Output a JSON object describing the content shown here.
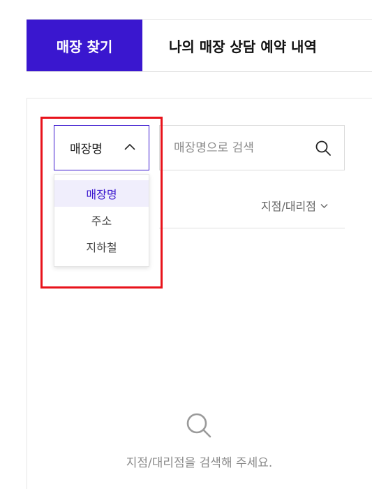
{
  "tabs": [
    {
      "label": "매장 찾기",
      "active": true
    },
    {
      "label": "나의 매장 상담 예약 내역",
      "active": false
    }
  ],
  "search": {
    "type_selected": "매장명",
    "type_options": [
      "매장명",
      "주소",
      "지하철"
    ],
    "placeholder": "매장명으로 검색",
    "button_icon": "search-icon"
  },
  "filter": {
    "label": "지점/대리점",
    "icon": "chevron-down-icon"
  },
  "empty_state": {
    "icon": "search-icon",
    "message": "지점/대리점을 검색해 주세요."
  },
  "colors": {
    "accent": "#3a17cf",
    "highlight": "#e8131b",
    "selected_bg": "#f0eefc"
  }
}
